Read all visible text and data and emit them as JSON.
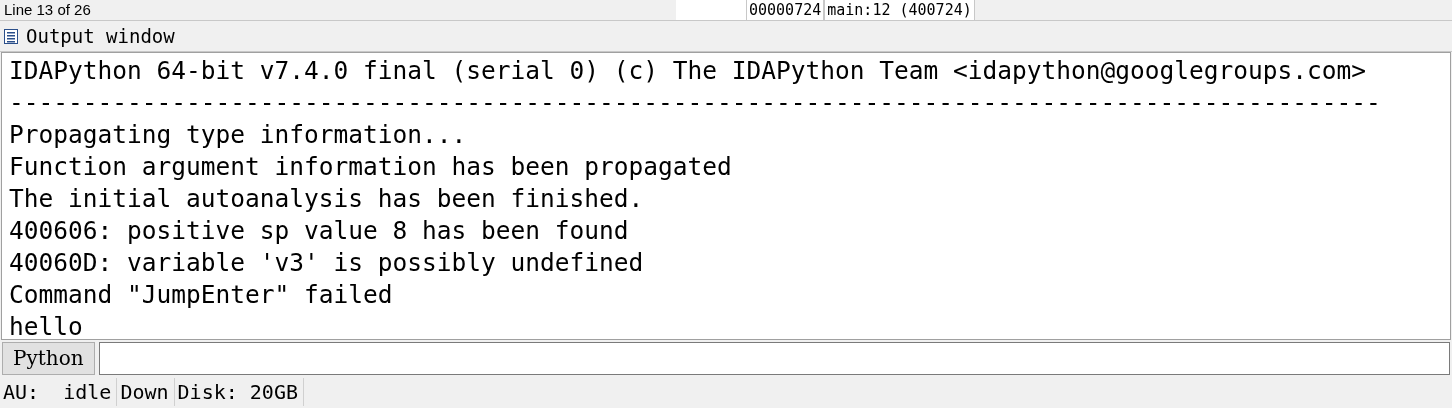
{
  "top_strip": {
    "line_info": "Line 13 of 26",
    "address": "00000724",
    "location": "main:12 (400724)"
  },
  "output_window": {
    "title": "Output window",
    "lines": [
      "IDAPython 64-bit v7.4.0 final (serial 0) (c) The IDAPython Team <idapython@googlegroups.com>",
      "---------------------------------------------------------------------------------------------",
      "Propagating type information...",
      "Function argument information has been propagated",
      "The initial autoanalysis has been finished.",
      "400606: positive sp value 8 has been found",
      "40060D: variable 'v3' is possibly undefined",
      "Command \"JumpEnter\" failed",
      "hello"
    ]
  },
  "command_bar": {
    "language_button": "Python"
  },
  "status_bar": {
    "items": [
      "AU:  idle",
      "Down",
      "Disk: 20GB"
    ]
  }
}
